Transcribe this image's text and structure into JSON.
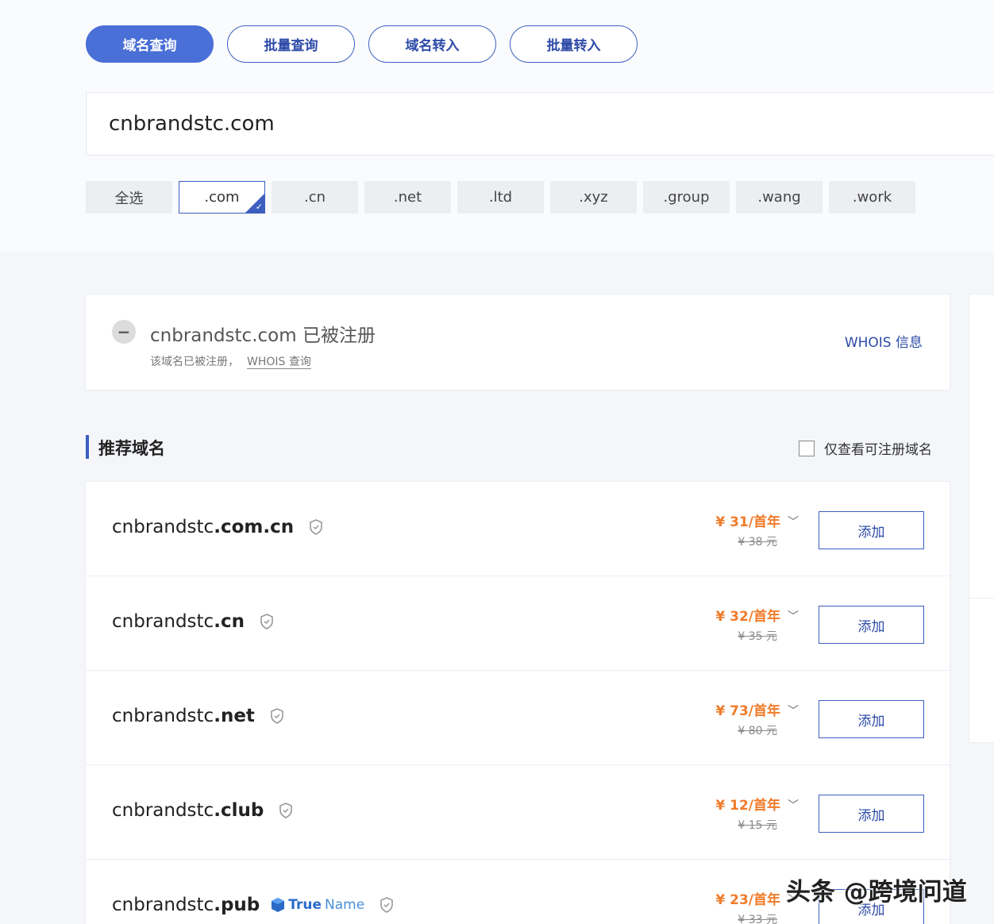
{
  "tabs": [
    "域名查询",
    "批量查询",
    "域名转入",
    "批量转入"
  ],
  "search": {
    "value": "cnbrandstc.com"
  },
  "tld_filters": [
    "全选",
    ".com",
    ".cn",
    ".net",
    ".ltd",
    ".xyz",
    ".group",
    ".wang",
    ".work"
  ],
  "selected_tld": ".com",
  "registered": {
    "domain": "cnbrandstc.com",
    "status": "已被注册",
    "sub_text": "该域名已被注册，",
    "sub_link": "WHOIS 查询",
    "whois_label": "WHOIS 信息"
  },
  "recommend": {
    "title": "推荐域名",
    "filter_label": "仅查看可注册域名",
    "items": [
      {
        "name": "cnbrandstc",
        "tld": ".com.cn",
        "price": "¥ 31/首年",
        "orig": "¥ 38 元",
        "add": "添加"
      },
      {
        "name": "cnbrandstc",
        "tld": ".cn",
        "price": "¥ 32/首年",
        "orig": "¥ 35 元",
        "add": "添加"
      },
      {
        "name": "cnbrandstc",
        "tld": ".net",
        "price": "¥ 73/首年",
        "orig": "¥ 80 元",
        "add": "添加"
      },
      {
        "name": "cnbrandstc",
        "tld": ".club",
        "price": "¥ 12/首年",
        "orig": "¥ 15 元",
        "add": "添加"
      },
      {
        "name": "cnbrandstc",
        "tld": ".pub",
        "price": "¥ 23/首年",
        "orig": "¥ 33 元",
        "add": "添加",
        "badge_a": "True",
        "badge_b": "Name"
      }
    ]
  },
  "watermark": "头条 @跨境问道",
  "colors": {
    "accent": "#3d5fc0",
    "price": "#f07b2a"
  }
}
